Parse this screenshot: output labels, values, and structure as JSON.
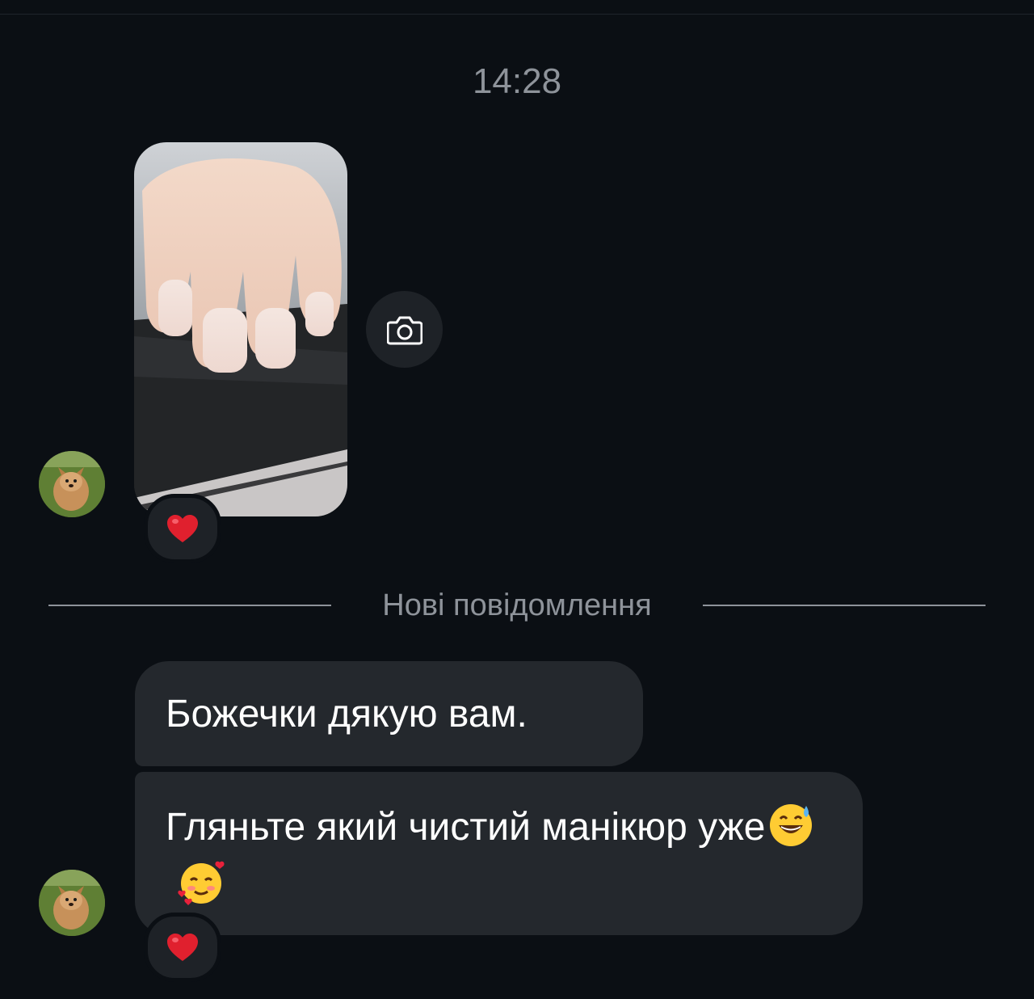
{
  "conversation": {
    "timestamp": "14:28",
    "new_messages_divider": "Нові повідомлення",
    "photo_message": {
      "reaction": "❤️"
    },
    "messages": [
      {
        "text": "Божечки дякую вам."
      },
      {
        "text": "Гляньте який чистий  манікюр уже",
        "emojis": [
          "😅",
          "🥰"
        ],
        "reaction": "❤️"
      }
    ]
  },
  "icons": {
    "camera": "camera-icon",
    "heart": "heart-icon",
    "avatar": "avatar"
  },
  "colors": {
    "background": "#0b0f14",
    "bubble": "#24282d",
    "muted_text": "#8e939a",
    "heart": "#e0202e"
  }
}
